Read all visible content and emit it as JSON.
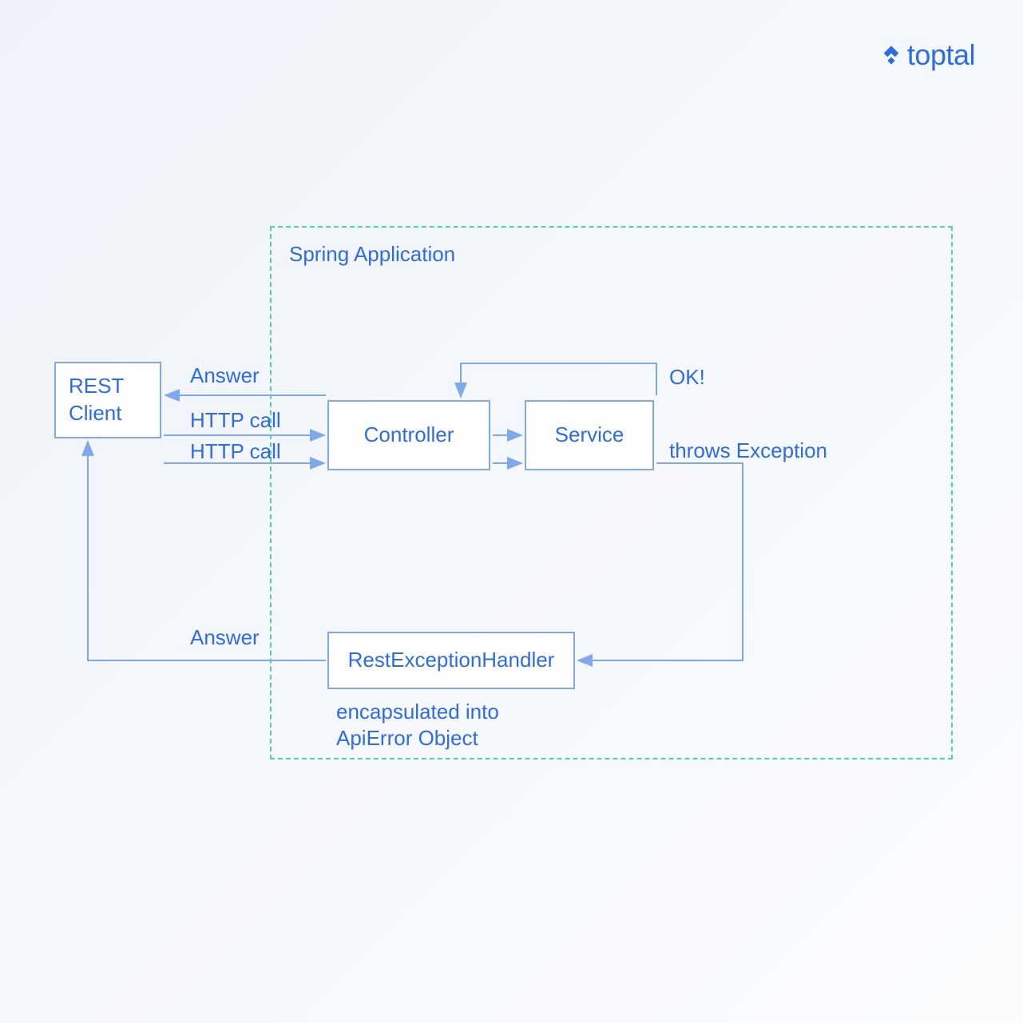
{
  "logo": {
    "text": "toptal"
  },
  "container": {
    "label": "Spring Application"
  },
  "boxes": {
    "rest_client": "REST Client",
    "controller": "Controller",
    "service": "Service",
    "handler": "RestExceptionHandler"
  },
  "edges": {
    "answer_top": "Answer",
    "http_call_1": "HTTP call",
    "http_call_2": "HTTP call",
    "ok": "OK!",
    "throws_exception": "throws Exception",
    "answer_bottom": "Answer",
    "encapsulated_line1": "encapsulated into",
    "encapsulated_line2": "ApiError Object"
  },
  "colors": {
    "primary_blue": "#2e6be6",
    "line_blue": "#7fa8ed",
    "dash_green": "#4fd694",
    "box_fill": "#ffffff"
  }
}
